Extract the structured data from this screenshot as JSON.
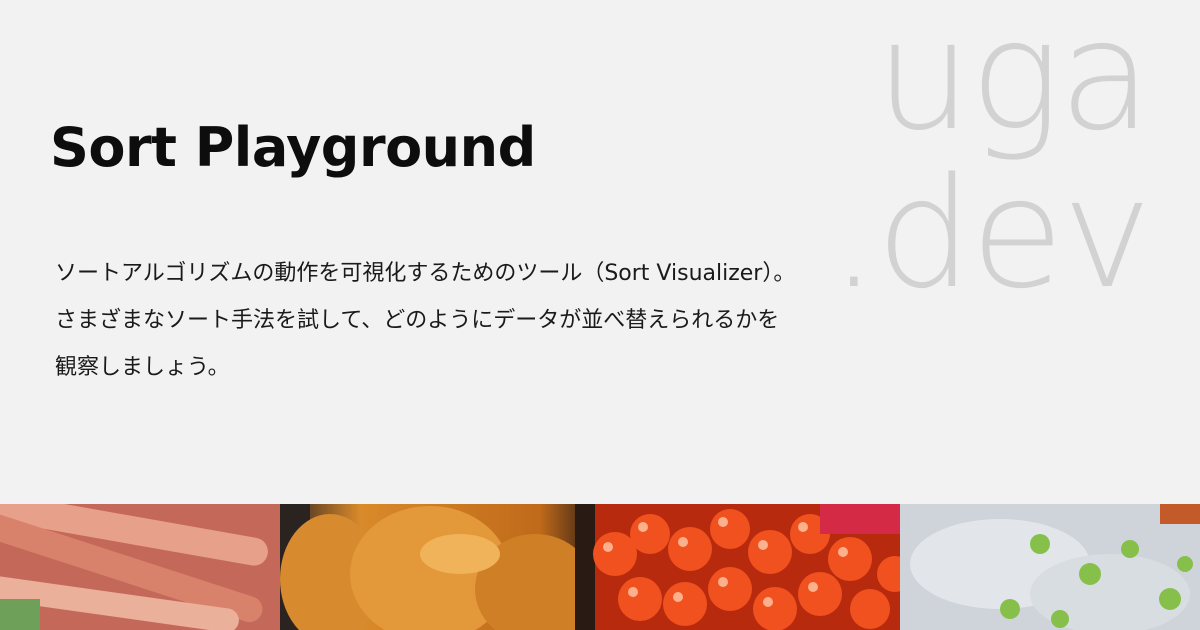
{
  "title": "Sort Playground",
  "description_lines": [
    "ソートアルゴリズムの動作を可視化するためのツール（Sort Visualizer）。",
    "さまざまなソート手法を試して、どのようにデータが並べ替えられるかを",
    "観察しましょう。"
  ],
  "logo": {
    "line1": "uga",
    "line2": ".dev"
  },
  "colors": {
    "background": "#f2f2f2",
    "title": "#0d0d0d",
    "logo": "#d2d2d2"
  }
}
